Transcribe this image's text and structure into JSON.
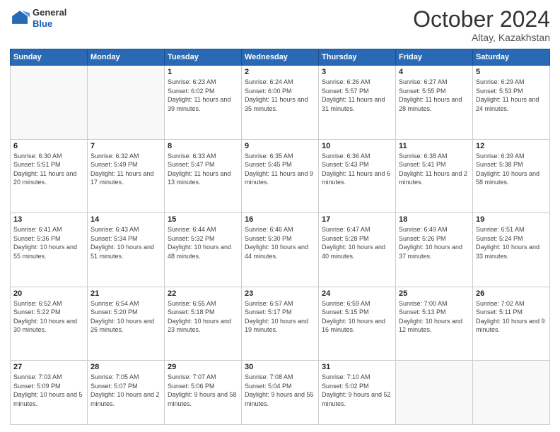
{
  "header": {
    "logo_general": "General",
    "logo_blue": "Blue",
    "month_year": "October 2024",
    "location": "Altay, Kazakhstan"
  },
  "weekdays": [
    "Sunday",
    "Monday",
    "Tuesday",
    "Wednesday",
    "Thursday",
    "Friday",
    "Saturday"
  ],
  "weeks": [
    [
      {
        "day": "",
        "sunrise": "",
        "sunset": "",
        "daylight": ""
      },
      {
        "day": "",
        "sunrise": "",
        "sunset": "",
        "daylight": ""
      },
      {
        "day": "1",
        "sunrise": "Sunrise: 6:23 AM",
        "sunset": "Sunset: 6:02 PM",
        "daylight": "Daylight: 11 hours and 39 minutes."
      },
      {
        "day": "2",
        "sunrise": "Sunrise: 6:24 AM",
        "sunset": "Sunset: 6:00 PM",
        "daylight": "Daylight: 11 hours and 35 minutes."
      },
      {
        "day": "3",
        "sunrise": "Sunrise: 6:26 AM",
        "sunset": "Sunset: 5:57 PM",
        "daylight": "Daylight: 11 hours and 31 minutes."
      },
      {
        "day": "4",
        "sunrise": "Sunrise: 6:27 AM",
        "sunset": "Sunset: 5:55 PM",
        "daylight": "Daylight: 11 hours and 28 minutes."
      },
      {
        "day": "5",
        "sunrise": "Sunrise: 6:29 AM",
        "sunset": "Sunset: 5:53 PM",
        "daylight": "Daylight: 11 hours and 24 minutes."
      }
    ],
    [
      {
        "day": "6",
        "sunrise": "Sunrise: 6:30 AM",
        "sunset": "Sunset: 5:51 PM",
        "daylight": "Daylight: 11 hours and 20 minutes."
      },
      {
        "day": "7",
        "sunrise": "Sunrise: 6:32 AM",
        "sunset": "Sunset: 5:49 PM",
        "daylight": "Daylight: 11 hours and 17 minutes."
      },
      {
        "day": "8",
        "sunrise": "Sunrise: 6:33 AM",
        "sunset": "Sunset: 5:47 PM",
        "daylight": "Daylight: 11 hours and 13 minutes."
      },
      {
        "day": "9",
        "sunrise": "Sunrise: 6:35 AM",
        "sunset": "Sunset: 5:45 PM",
        "daylight": "Daylight: 11 hours and 9 minutes."
      },
      {
        "day": "10",
        "sunrise": "Sunrise: 6:36 AM",
        "sunset": "Sunset: 5:43 PM",
        "daylight": "Daylight: 11 hours and 6 minutes."
      },
      {
        "day": "11",
        "sunrise": "Sunrise: 6:38 AM",
        "sunset": "Sunset: 5:41 PM",
        "daylight": "Daylight: 11 hours and 2 minutes."
      },
      {
        "day": "12",
        "sunrise": "Sunrise: 6:39 AM",
        "sunset": "Sunset: 5:38 PM",
        "daylight": "Daylight: 10 hours and 58 minutes."
      }
    ],
    [
      {
        "day": "13",
        "sunrise": "Sunrise: 6:41 AM",
        "sunset": "Sunset: 5:36 PM",
        "daylight": "Daylight: 10 hours and 55 minutes."
      },
      {
        "day": "14",
        "sunrise": "Sunrise: 6:43 AM",
        "sunset": "Sunset: 5:34 PM",
        "daylight": "Daylight: 10 hours and 51 minutes."
      },
      {
        "day": "15",
        "sunrise": "Sunrise: 6:44 AM",
        "sunset": "Sunset: 5:32 PM",
        "daylight": "Daylight: 10 hours and 48 minutes."
      },
      {
        "day": "16",
        "sunrise": "Sunrise: 6:46 AM",
        "sunset": "Sunset: 5:30 PM",
        "daylight": "Daylight: 10 hours and 44 minutes."
      },
      {
        "day": "17",
        "sunrise": "Sunrise: 6:47 AM",
        "sunset": "Sunset: 5:28 PM",
        "daylight": "Daylight: 10 hours and 40 minutes."
      },
      {
        "day": "18",
        "sunrise": "Sunrise: 6:49 AM",
        "sunset": "Sunset: 5:26 PM",
        "daylight": "Daylight: 10 hours and 37 minutes."
      },
      {
        "day": "19",
        "sunrise": "Sunrise: 6:51 AM",
        "sunset": "Sunset: 5:24 PM",
        "daylight": "Daylight: 10 hours and 33 minutes."
      }
    ],
    [
      {
        "day": "20",
        "sunrise": "Sunrise: 6:52 AM",
        "sunset": "Sunset: 5:22 PM",
        "daylight": "Daylight: 10 hours and 30 minutes."
      },
      {
        "day": "21",
        "sunrise": "Sunrise: 6:54 AM",
        "sunset": "Sunset: 5:20 PM",
        "daylight": "Daylight: 10 hours and 26 minutes."
      },
      {
        "day": "22",
        "sunrise": "Sunrise: 6:55 AM",
        "sunset": "Sunset: 5:18 PM",
        "daylight": "Daylight: 10 hours and 23 minutes."
      },
      {
        "day": "23",
        "sunrise": "Sunrise: 6:57 AM",
        "sunset": "Sunset: 5:17 PM",
        "daylight": "Daylight: 10 hours and 19 minutes."
      },
      {
        "day": "24",
        "sunrise": "Sunrise: 6:59 AM",
        "sunset": "Sunset: 5:15 PM",
        "daylight": "Daylight: 10 hours and 16 minutes."
      },
      {
        "day": "25",
        "sunrise": "Sunrise: 7:00 AM",
        "sunset": "Sunset: 5:13 PM",
        "daylight": "Daylight: 10 hours and 12 minutes."
      },
      {
        "day": "26",
        "sunrise": "Sunrise: 7:02 AM",
        "sunset": "Sunset: 5:11 PM",
        "daylight": "Daylight: 10 hours and 9 minutes."
      }
    ],
    [
      {
        "day": "27",
        "sunrise": "Sunrise: 7:03 AM",
        "sunset": "Sunset: 5:09 PM",
        "daylight": "Daylight: 10 hours and 5 minutes."
      },
      {
        "day": "28",
        "sunrise": "Sunrise: 7:05 AM",
        "sunset": "Sunset: 5:07 PM",
        "daylight": "Daylight: 10 hours and 2 minutes."
      },
      {
        "day": "29",
        "sunrise": "Sunrise: 7:07 AM",
        "sunset": "Sunset: 5:06 PM",
        "daylight": "Daylight: 9 hours and 58 minutes."
      },
      {
        "day": "30",
        "sunrise": "Sunrise: 7:08 AM",
        "sunset": "Sunset: 5:04 PM",
        "daylight": "Daylight: 9 hours and 55 minutes."
      },
      {
        "day": "31",
        "sunrise": "Sunrise: 7:10 AM",
        "sunset": "Sunset: 5:02 PM",
        "daylight": "Daylight: 9 hours and 52 minutes."
      },
      {
        "day": "",
        "sunrise": "",
        "sunset": "",
        "daylight": ""
      },
      {
        "day": "",
        "sunrise": "",
        "sunset": "",
        "daylight": ""
      }
    ]
  ]
}
